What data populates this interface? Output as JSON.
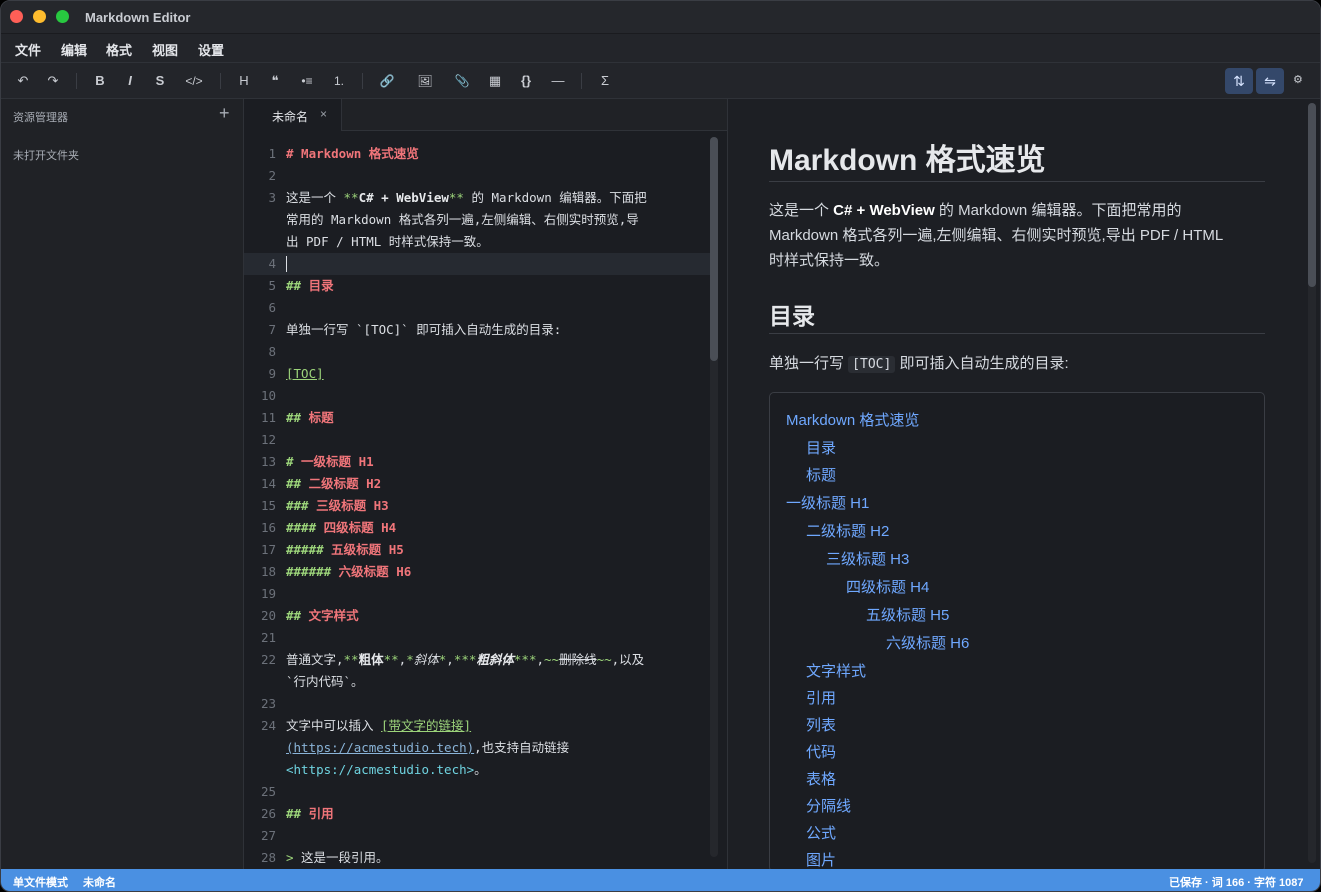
{
  "window": {
    "title": "Markdown Editor"
  },
  "menu": [
    "文件",
    "编辑",
    "格式",
    "视图",
    "设置"
  ],
  "toolbar": {
    "undo": "↶",
    "redo": "↷",
    "bold": "B",
    "italic": "I",
    "strike": "S",
    "code": "</>",
    "heading": "H",
    "quote": "❝",
    "ul": "•≡",
    "ol": "1.",
    "link": "🔗",
    "image": "🖼",
    "attach": "📎",
    "table": "▦",
    "codeblock": "{}",
    "hr": "—",
    "math": "Σ",
    "sync_scroll": "⇅",
    "swap": "⇋",
    "settings": "⚙"
  },
  "sidebar": {
    "title": "资源管理器",
    "add": "+",
    "empty": "未打开文件夹"
  },
  "tab": {
    "label": "未命名",
    "close": "×"
  },
  "editor_lines": [
    {
      "n": "1",
      "t": "# Markdown 格式速览"
    },
    {
      "n": "2",
      "t": ""
    },
    {
      "n": "3",
      "t": "这是一个 **C# + WebView** 的 Markdown 编辑器。下面把"
    },
    {
      "n": "",
      "t": "常用的 Markdown 格式各列一遍,左侧编辑、右侧实时预览,导"
    },
    {
      "n": "",
      "t": "出 PDF / HTML 时样式保持一致。"
    },
    {
      "n": "4",
      "t": ""
    },
    {
      "n": "5",
      "t": "## 目录"
    },
    {
      "n": "6",
      "t": ""
    },
    {
      "n": "7",
      "t": "单独一行写 `[TOC]` 即可插入自动生成的目录:"
    },
    {
      "n": "8",
      "t": ""
    },
    {
      "n": "9",
      "t": "[TOC]"
    },
    {
      "n": "10",
      "t": ""
    },
    {
      "n": "11",
      "t": "## 标题"
    },
    {
      "n": "12",
      "t": ""
    },
    {
      "n": "13",
      "t": "# 一级标题 H1"
    },
    {
      "n": "14",
      "t": "## 二级标题 H2"
    },
    {
      "n": "15",
      "t": "### 三级标题 H3"
    },
    {
      "n": "16",
      "t": "#### 四级标题 H4"
    },
    {
      "n": "17",
      "t": "##### 五级标题 H5"
    },
    {
      "n": "18",
      "t": "###### 六级标题 H6"
    },
    {
      "n": "19",
      "t": ""
    },
    {
      "n": "20",
      "t": "## 文字样式"
    },
    {
      "n": "21",
      "t": ""
    },
    {
      "n": "22",
      "t": "普通文字,**粗体**,*斜体*,***粗斜体***,~~删除线~~,以及"
    },
    {
      "n": "",
      "t": "`行内代码`。"
    },
    {
      "n": "23",
      "t": ""
    },
    {
      "n": "24",
      "t": "文字中可以插入 [带文字的链接]"
    },
    {
      "n": "",
      "t": "(https://acmestudio.tech),也支持自动链接"
    },
    {
      "n": "",
      "t": "<https://acmestudio.tech>。"
    },
    {
      "n": "25",
      "t": ""
    },
    {
      "n": "26",
      "t": "## 引用"
    },
    {
      "n": "27",
      "t": ""
    },
    {
      "n": "28",
      "t": "> 这是一段引用。"
    }
  ],
  "preview": {
    "h1": "Markdown 格式速览",
    "intro_prefix": "这是一个 ",
    "intro_bold": "C# + WebView",
    "intro_rest1": " 的 Markdown 编辑器。下面把常用的",
    "intro_line2": "Markdown 格式各列一遍,左侧编辑、右侧实时预览,导出 PDF / HTML",
    "intro_line3": "时样式保持一致。",
    "h2": "目录",
    "toc_line_prefix": "单独一行写 ",
    "toc_line_code": "[TOC]",
    "toc_line_suffix": " 即可插入自动生成的目录:",
    "toc": [
      {
        "label": "Markdown 格式速览",
        "level": 0
      },
      {
        "label": "目录",
        "level": 1
      },
      {
        "label": "标题",
        "level": 1
      },
      {
        "label": "一级标题 H1",
        "level": 0
      },
      {
        "label": "二级标题 H2",
        "level": 1
      },
      {
        "label": "三级标题 H3",
        "level": 2
      },
      {
        "label": "四级标题 H4",
        "level": 3
      },
      {
        "label": "五级标题 H5",
        "level": 4
      },
      {
        "label": "六级标题 H6",
        "level": 5
      },
      {
        "label": "文字样式",
        "level": 1
      },
      {
        "label": "引用",
        "level": 1
      },
      {
        "label": "列表",
        "level": 1
      },
      {
        "label": "代码",
        "level": 1
      },
      {
        "label": "表格",
        "level": 1
      },
      {
        "label": "分隔线",
        "level": 1
      },
      {
        "label": "公式",
        "level": 1
      },
      {
        "label": "图片",
        "level": 1
      }
    ]
  },
  "status": {
    "mode": "单文件模式",
    "file": "未命名",
    "right": "已保存 · 词 166 · 字符 1087"
  },
  "colors": {
    "accent": "#4a90e2",
    "heading": "#f0757a",
    "markup": "#9cd47a",
    "link": "#6fa8ff"
  }
}
